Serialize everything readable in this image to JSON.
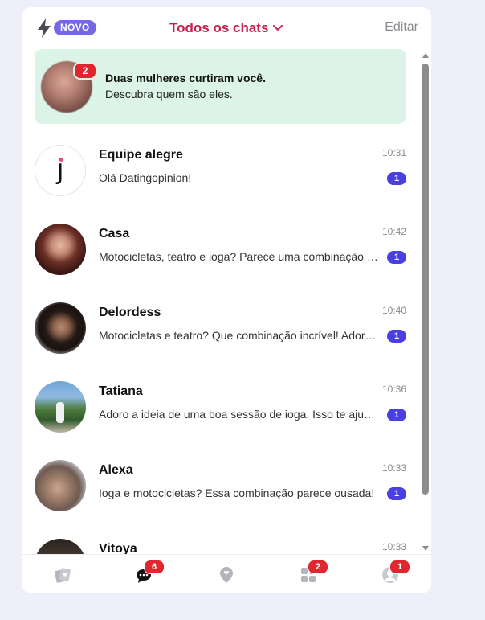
{
  "header": {
    "badge": "NOVO",
    "title": "Todos os chats",
    "edit": "Editar"
  },
  "likes": {
    "count": "2",
    "title": "Duas mulheres curtiram você.",
    "subtitle": "Descubra quem são eles."
  },
  "chats": [
    {
      "name": "Equipe alegre",
      "preview": "Olá Datingopinion!",
      "time": "10:31",
      "unread": "1"
    },
    {
      "name": "Casa",
      "preview": "Motocicletas, teatro e ioga? Parece uma combinação interessante!",
      "time": "10:42",
      "unread": "1"
    },
    {
      "name": "Delordess",
      "preview": "Motocicletas e teatro? Que combinação incrível! Adoraria saber mais",
      "time": "10:40",
      "unread": "1"
    },
    {
      "name": "Tatiana",
      "preview": "Adoro a ideia de uma boa sessão de ioga. Isso te ajuda a relaxar?",
      "time": "10:36",
      "unread": "1"
    },
    {
      "name": "Alexa",
      "preview": "Ioga e motocicletas? Essa combinação parece ousada!",
      "time": "10:33",
      "unread": "1"
    },
    {
      "name": "Vitoya",
      "preview": "",
      "time": "10:33",
      "unread": ""
    }
  ],
  "nav": {
    "cards_badge": "",
    "chats_badge": "6",
    "nearby_badge": "",
    "apps_badge": "2",
    "profile_badge": "1"
  },
  "colors": {
    "accent": "#c4234f",
    "badge_purple": "#7467e8",
    "unread_blue": "#4a3fe0",
    "notification_red": "#e0262f",
    "likes_card_bg": "#dcf3e8"
  }
}
